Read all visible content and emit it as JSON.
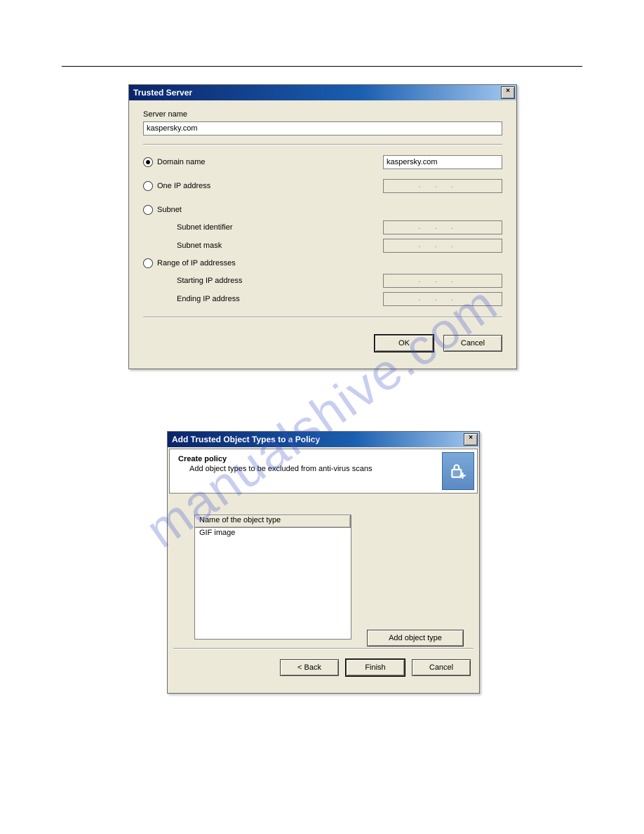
{
  "watermark": "manualshive.com",
  "dialog1": {
    "title": "Trusted Server",
    "close_label": "×",
    "server_name_label": "Server name",
    "server_name_value": "kaspersky.com",
    "options": {
      "domain": {
        "label": "Domain name",
        "value": "kaspersky.com",
        "checked": true
      },
      "one_ip": {
        "label": "One IP address",
        "checked": false
      },
      "subnet": {
        "label": "Subnet",
        "checked": false
      },
      "subnet_identifier_label": "Subnet identifier",
      "subnet_mask_label": "Subnet mask",
      "range": {
        "label": "Range of IP addresses",
        "checked": false
      },
      "starting_ip_label": "Starting IP address",
      "ending_ip_label": "Ending IP address"
    },
    "ip_placeholder": "...",
    "buttons": {
      "ok": "OK",
      "cancel": "Cancel"
    }
  },
  "dialog2": {
    "title": "Add Trusted Object Types to a Policy",
    "close_label": "×",
    "header": {
      "heading": "Create policy",
      "sub": "Add object types to be excluded from anti-virus scans",
      "icon": "lock-plus-icon"
    },
    "list": {
      "column": "Name of the object type",
      "rows": [
        "GIF image"
      ]
    },
    "add_button": "Add object type",
    "footer": {
      "back": "< Back",
      "finish": "Finish",
      "cancel": "Cancel"
    }
  }
}
